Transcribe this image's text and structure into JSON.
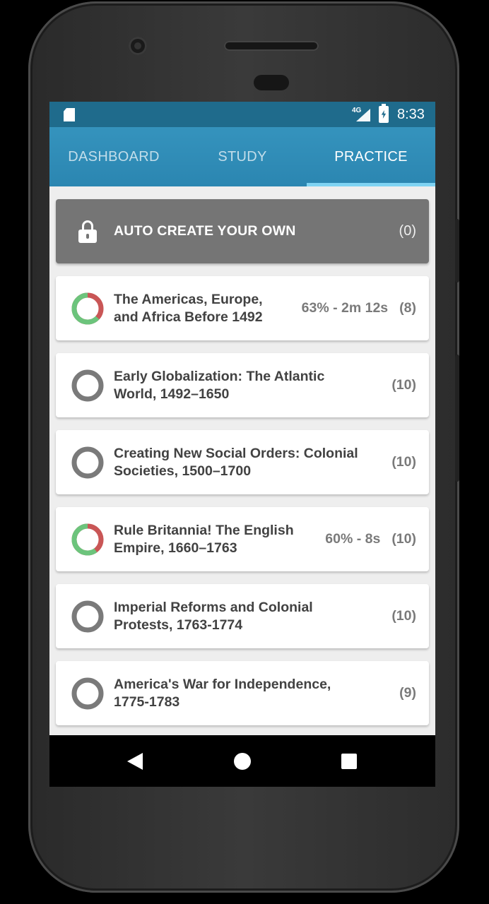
{
  "status": {
    "network": "4G",
    "time": "8:33"
  },
  "tabs": [
    {
      "label": "DASHBOARD",
      "active": false
    },
    {
      "label": "STUDY",
      "active": false
    },
    {
      "label": "PRACTICE",
      "active": true
    }
  ],
  "colors": {
    "header": "#2b86b1",
    "status_bar": "#1f6b8c",
    "correct": "#6cc47c",
    "incorrect": "#c95656",
    "unattempted": "#7a7a7a"
  },
  "auto_create": {
    "label": "AUTO CREATE YOUR OWN",
    "count": "(0)"
  },
  "items": [
    {
      "title_line1": "The Americas, Europe,",
      "title_line2": "and Africa Before 1492",
      "stats": "63% - 2m 12s",
      "count": "(8)",
      "score": 0.63
    },
    {
      "title_line1": "Early Globalization: The Atlantic",
      "title_line2": "World, 1492–1650",
      "stats": "",
      "count": "(10)",
      "score": null
    },
    {
      "title_line1": "Creating New Social Orders: Colonial",
      "title_line2": "Societies, 1500–1700",
      "stats": "",
      "count": "(10)",
      "score": null
    },
    {
      "title_line1": "Rule Britannia! The English",
      "title_line2": "Empire, 1660–1763",
      "stats": "60% - 8s",
      "count": "(10)",
      "score": 0.6
    },
    {
      "title_line1": "Imperial Reforms and Colonial",
      "title_line2": "Protests, 1763-1774",
      "stats": "",
      "count": "(10)",
      "score": null
    },
    {
      "title_line1": "America's War for Independence,",
      "title_line2": "1775-1783",
      "stats": "",
      "count": "(9)",
      "score": null
    }
  ]
}
